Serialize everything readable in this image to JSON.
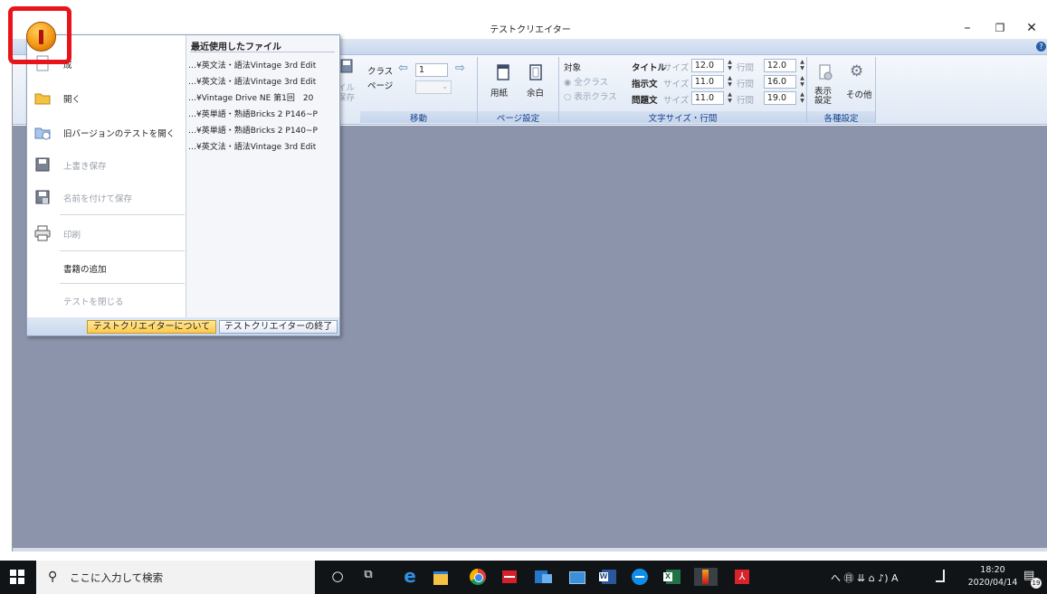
{
  "window": {
    "title": "テストクリエイター",
    "controls": {
      "minimize": "–",
      "maximize": "❐",
      "close": "✕"
    },
    "help_icon": "?"
  },
  "ribbon": {
    "partial_file_labels": [
      "イル",
      "保存"
    ],
    "groups": {
      "move": {
        "label": "移動",
        "class_label": "クラス",
        "class_value": "1",
        "page_label": "ページ"
      },
      "page_setup": {
        "label": "ページ設定",
        "paper": "用紙",
        "margin": "余白"
      },
      "text_size": {
        "label": "文字サイズ・行間",
        "target_label": "対象",
        "all_classes": "全クラス",
        "shown_classes": "表示クラス",
        "size_label": "サイズ",
        "spacing_label": "行間",
        "rows": [
          {
            "name": "タイトル",
            "size": "12.0",
            "spacing": "12.0"
          },
          {
            "name": "指示文",
            "size": "11.0",
            "spacing": "16.0"
          },
          {
            "name": "問題文",
            "size": "11.0",
            "spacing": "19.0"
          }
        ]
      },
      "settings": {
        "label": "各種設定",
        "display_line1": "表示",
        "display_line2": "設定",
        "other": "その他"
      }
    }
  },
  "app_menu": {
    "items": [
      {
        "label": "成",
        "enabled": true,
        "icon": "new-document-icon"
      },
      {
        "label": "開く",
        "enabled": true,
        "icon": "folder-open-icon"
      },
      {
        "label": "旧バージョンのテストを開く",
        "enabled": true,
        "icon": "folder-old-version-icon"
      },
      {
        "label": "上書き保存",
        "enabled": false,
        "icon": "save-icon"
      },
      {
        "label": "名前を付けて保存",
        "enabled": false,
        "icon": "save-as-icon"
      },
      {
        "label": "印刷",
        "enabled": false,
        "icon": "printer-icon"
      },
      {
        "label": "書籍の追加",
        "enabled": true,
        "icon": ""
      },
      {
        "label": "テストを閉じる",
        "enabled": false,
        "icon": ""
      }
    ],
    "recent_title": "最近使用したファイル",
    "recent_files": [
      "…¥英文法・語法Vintage 3rd Edit",
      "…¥英文法・語法Vintage 3rd Edit",
      "…¥Vintage Drive NE 第1回　20",
      "…¥英単語・熟語Bricks 2 P146~P",
      "…¥英単語・熟語Bricks 2 P140~P",
      "…¥英文法・語法Vintage 3rd Edit"
    ],
    "about_button": "テストクリエイターについて",
    "exit_button": "テストクリエイターの終了"
  },
  "taskbar": {
    "search_placeholder": "ここに入力して検索",
    "tray_text": "へ ㊐ ⇊ ⌂ ♪) A",
    "clock_time": "18:20",
    "clock_date": "2020/04/14",
    "notification_count": "19"
  },
  "colors": {
    "highlight": "#e8141a",
    "orb": "#f39a16",
    "client_bg": "#8c94ab"
  }
}
